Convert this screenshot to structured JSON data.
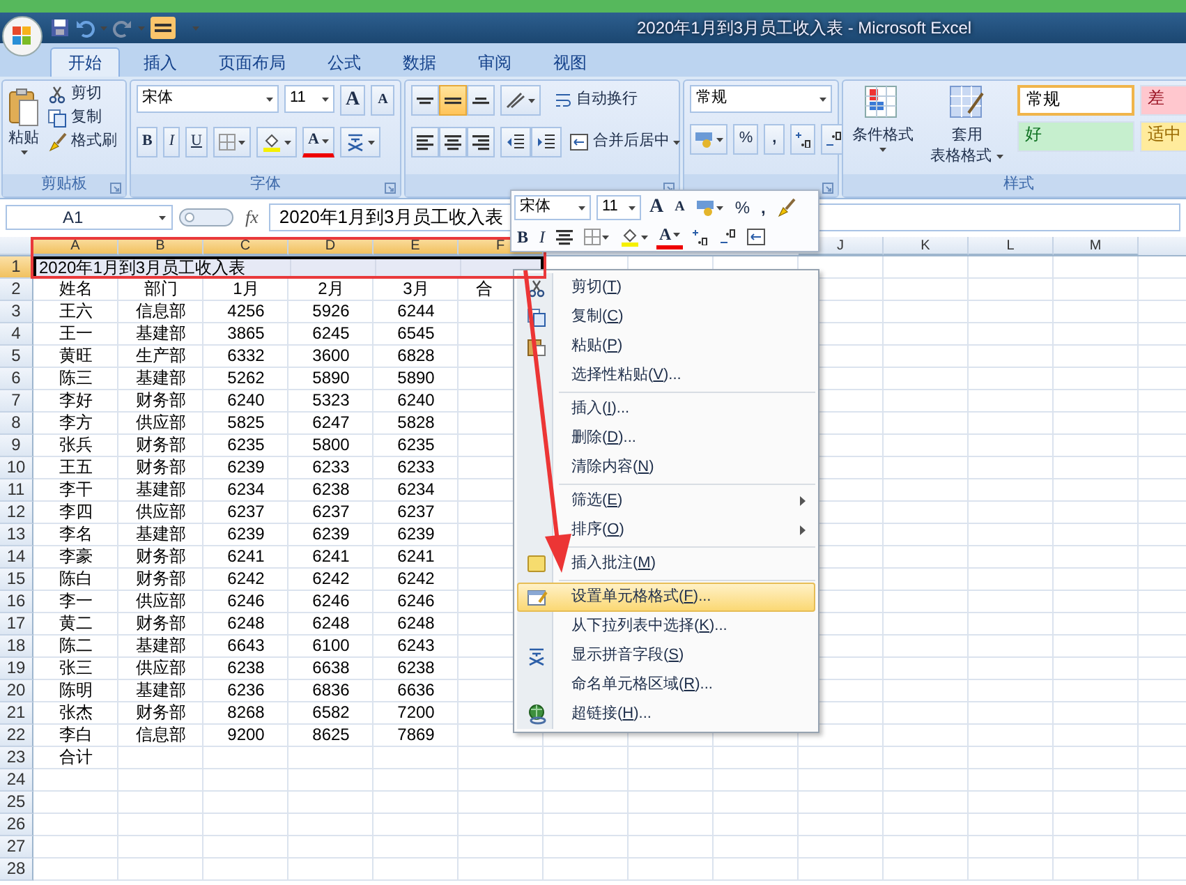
{
  "window": {
    "title": "2020年1月到3月员工收入表 - Microsoft Excel"
  },
  "tabs": [
    {
      "label": "开始",
      "selected": true
    },
    {
      "label": "插入",
      "selected": false
    },
    {
      "label": "页面布局",
      "selected": false
    },
    {
      "label": "公式",
      "selected": false
    },
    {
      "label": "数据",
      "selected": false
    },
    {
      "label": "审阅",
      "selected": false
    },
    {
      "label": "视图",
      "selected": false
    }
  ],
  "clipboard": {
    "label": "剪贴板",
    "paste": "粘贴",
    "actions": [
      {
        "label": "剪切",
        "kind": "cut"
      },
      {
        "label": "复制",
        "kind": "copy"
      },
      {
        "label": "格式刷",
        "kind": "brush"
      }
    ]
  },
  "font": {
    "label": "字体",
    "name": "宋体",
    "size": "11",
    "grow": "A",
    "shrink": "A",
    "styles": [
      "B",
      "I",
      "U"
    ],
    "color_letter": "A"
  },
  "alignment": {
    "vertical": [
      {
        "selected": false
      },
      {
        "selected": true
      },
      {
        "selected": false
      }
    ],
    "wrap": "自动换行",
    "merge": "合并后居中"
  },
  "number": {
    "format": "常规",
    "percent": "%",
    "comma": ","
  },
  "styles": {
    "label": "样式",
    "conditional": "条件格式",
    "table": [
      "套用",
      "表格格式"
    ],
    "cells": [
      {
        "label": "常规",
        "color": "#ffffff",
        "selected": true
      },
      {
        "label": "差",
        "color": "#ffc7ce",
        "selected": false
      },
      {
        "label": "好",
        "color": "#c6efce",
        "selected": false
      },
      {
        "label": "适中",
        "color": "#ffeb9c",
        "selected": false
      }
    ]
  },
  "formula_bar": {
    "name_box": "A1",
    "fx": "fx",
    "formula": "2020年1月到3月员工收入表"
  },
  "mini_toolbar": {
    "font": "宋体",
    "size": "11",
    "grow": "A",
    "shrink": "A",
    "percent": "%",
    "comma": ",",
    "bold": "B",
    "italic": "I",
    "color_letter": "A"
  },
  "sheet": {
    "columns": [
      {
        "label": "A",
        "selected": true
      },
      {
        "label": "B",
        "selected": true
      },
      {
        "label": "C",
        "selected": true
      },
      {
        "label": "D",
        "selected": true
      },
      {
        "label": "E",
        "selected": true
      },
      {
        "label": "F",
        "selected": true
      }
    ],
    "columns_right": [
      {
        "label": "J",
        "selected": false
      },
      {
        "label": "K",
        "selected": false
      },
      {
        "label": "L",
        "selected": false
      },
      {
        "label": "M",
        "selected": false
      }
    ],
    "rows": [
      {
        "number": "1",
        "selected": true,
        "cells": [
          "2020年1月到3月员工收入表"
        ]
      },
      {
        "number": "2",
        "selected": false,
        "cells": [
          "姓名",
          "部门",
          "1月",
          "2月",
          "3月",
          "合"
        ]
      },
      {
        "number": "3",
        "selected": false,
        "cells": [
          "王六",
          "信息部",
          "4256",
          "5926",
          "6244"
        ]
      },
      {
        "number": "4",
        "selected": false,
        "cells": [
          "王一",
          "基建部",
          "3865",
          "6245",
          "6545"
        ]
      },
      {
        "number": "5",
        "selected": false,
        "cells": [
          "黄旺",
          "生产部",
          "6332",
          "3600",
          "6828"
        ]
      },
      {
        "number": "6",
        "selected": false,
        "cells": [
          "陈三",
          "基建部",
          "5262",
          "5890",
          "5890"
        ]
      },
      {
        "number": "7",
        "selected": false,
        "cells": [
          "李好",
          "财务部",
          "6240",
          "5323",
          "6240"
        ]
      },
      {
        "number": "8",
        "selected": false,
        "cells": [
          "李方",
          "供应部",
          "5825",
          "6247",
          "5828"
        ]
      },
      {
        "number": "9",
        "selected": false,
        "cells": [
          "张兵",
          "财务部",
          "6235",
          "5800",
          "6235"
        ]
      },
      {
        "number": "10",
        "selected": false,
        "cells": [
          "王五",
          "财务部",
          "6239",
          "6233",
          "6233"
        ]
      },
      {
        "number": "11",
        "selected": false,
        "cells": [
          "李干",
          "基建部",
          "6234",
          "6238",
          "6234"
        ]
      },
      {
        "number": "12",
        "selected": false,
        "cells": [
          "李四",
          "供应部",
          "6237",
          "6237",
          "6237"
        ]
      },
      {
        "number": "13",
        "selected": false,
        "cells": [
          "李名",
          "基建部",
          "6239",
          "6239",
          "6239"
        ]
      },
      {
        "number": "14",
        "selected": false,
        "cells": [
          "李豪",
          "财务部",
          "6241",
          "6241",
          "6241"
        ]
      },
      {
        "number": "15",
        "selected": false,
        "cells": [
          "陈白",
          "财务部",
          "6242",
          "6242",
          "6242"
        ]
      },
      {
        "number": "16",
        "selected": false,
        "cells": [
          "李一",
          "供应部",
          "6246",
          "6246",
          "6246"
        ]
      },
      {
        "number": "17",
        "selected": false,
        "cells": [
          "黄二",
          "财务部",
          "6248",
          "6248",
          "6248"
        ]
      },
      {
        "number": "18",
        "selected": false,
        "cells": [
          "陈二",
          "基建部",
          "6643",
          "6100",
          "6243"
        ]
      },
      {
        "number": "19",
        "selected": false,
        "cells": [
          "张三",
          "供应部",
          "6238",
          "6638",
          "6238"
        ]
      },
      {
        "number": "20",
        "selected": false,
        "cells": [
          "陈明",
          "基建部",
          "6236",
          "6836",
          "6636"
        ]
      },
      {
        "number": "21",
        "selected": false,
        "cells": [
          "张杰",
          "财务部",
          "8268",
          "6582",
          "7200"
        ]
      },
      {
        "number": "22",
        "selected": false,
        "cells": [
          "李白",
          "信息部",
          "9200",
          "8625",
          "7869"
        ]
      },
      {
        "number": "23",
        "selected": false,
        "cells": [
          "合计"
        ]
      },
      {
        "number": "24",
        "selected": false
      },
      {
        "number": "25",
        "selected": false
      },
      {
        "number": "26",
        "selected": false
      },
      {
        "number": "27",
        "selected": false
      },
      {
        "number": "28",
        "selected": false
      }
    ]
  },
  "context_menu": {
    "groups": [
      [
        {
          "label": "剪切(T)",
          "kind": "cut",
          "selected": false,
          "submenu": false
        },
        {
          "label": "复制(C)",
          "kind": "copy",
          "selected": false,
          "submenu": false
        },
        {
          "label": "粘贴(P)",
          "kind": "paste",
          "selected": false,
          "submenu": false
        },
        {
          "label": "选择性粘贴(V)...",
          "kind": "plain",
          "selected": false,
          "submenu": false
        }
      ],
      [
        {
          "label": "插入(I)...",
          "kind": "plain",
          "selected": false,
          "submenu": false
        },
        {
          "label": "删除(D)...",
          "kind": "plain",
          "selected": false,
          "submenu": false
        },
        {
          "label": "清除内容(N)",
          "kind": "plain",
          "selected": false,
          "submenu": false
        }
      ],
      [
        {
          "label": "筛选(E)",
          "kind": "plain",
          "selected": false,
          "submenu": true
        },
        {
          "label": "排序(O)",
          "kind": "plain",
          "selected": false,
          "submenu": true
        }
      ],
      [
        {
          "label": "插入批注(M)",
          "kind": "comment",
          "selected": false,
          "submenu": false
        }
      ],
      [
        {
          "label": "设置单元格格式(F)...",
          "kind": "format",
          "selected": true,
          "submenu": false
        },
        {
          "label": "从下拉列表中选择(K)...",
          "kind": "plain",
          "selected": false,
          "submenu": false
        },
        {
          "label": "显示拼音字段(S)",
          "kind": "phonetic",
          "selected": false,
          "submenu": false
        },
        {
          "label": "命名单元格区域(R)...",
          "kind": "plain",
          "selected": false,
          "submenu": false
        },
        {
          "label": "超链接(H)...",
          "kind": "link",
          "selected": false,
          "submenu": false
        }
      ]
    ]
  }
}
